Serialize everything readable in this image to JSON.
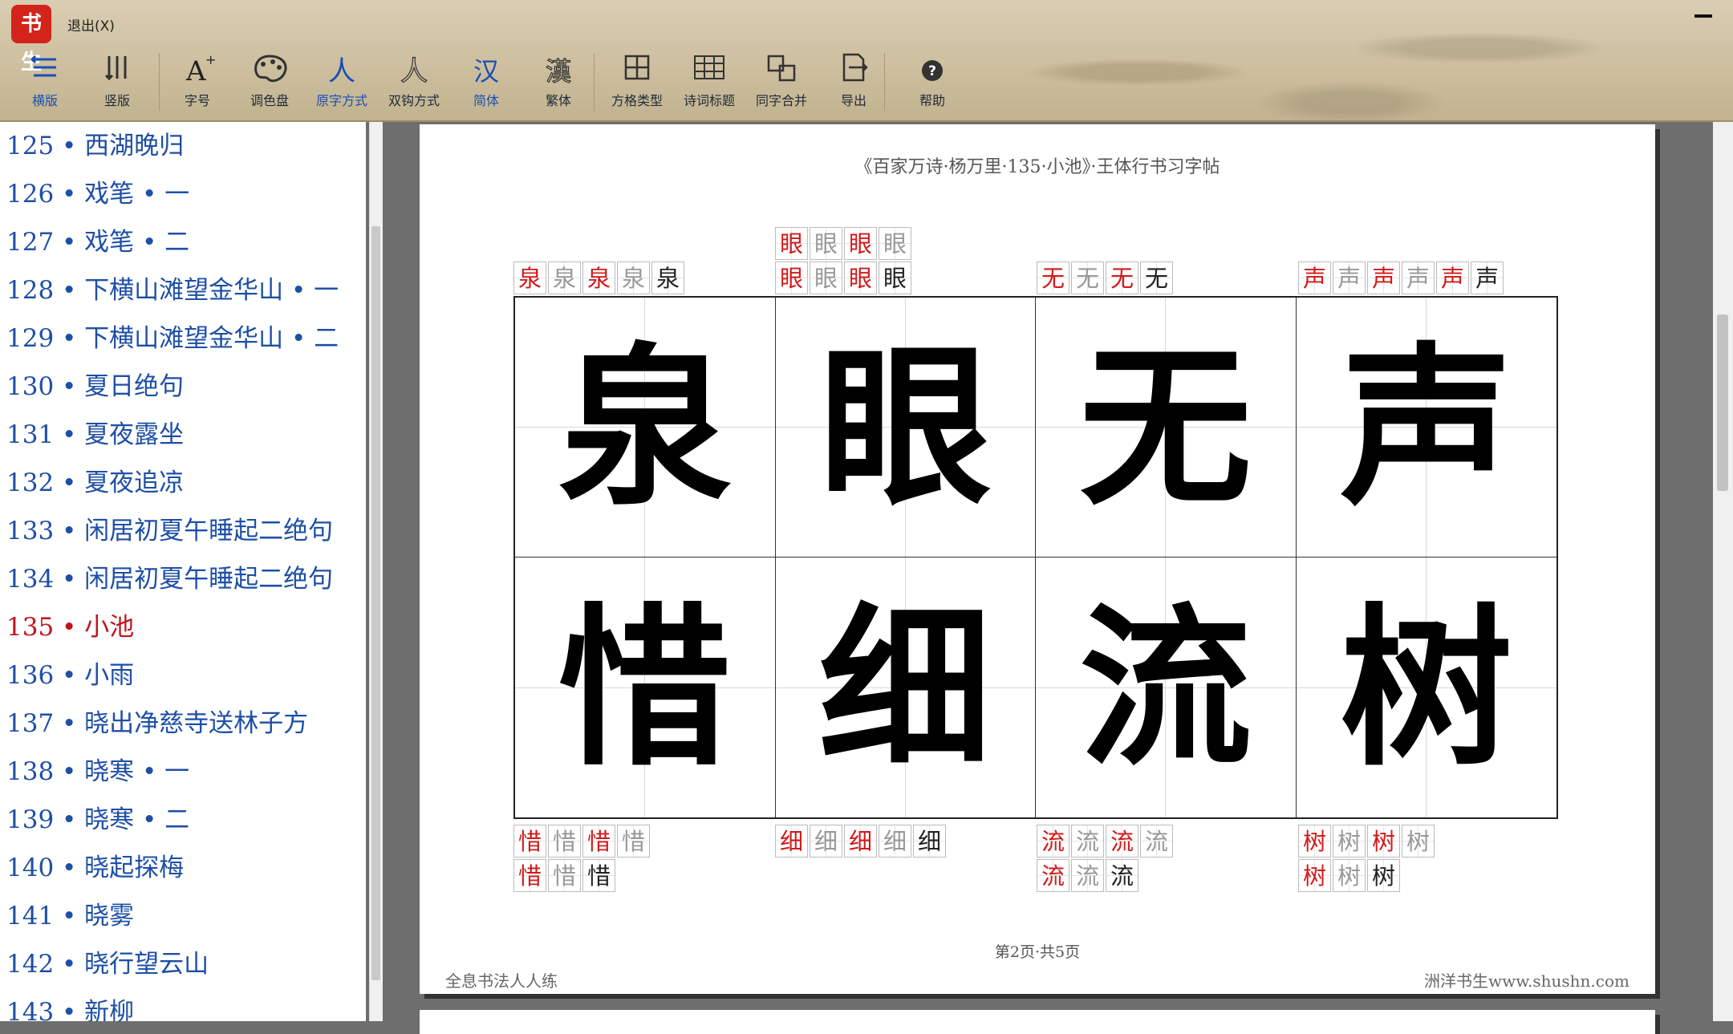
{
  "app": {
    "logo": "书生",
    "exit_label": "退出(X)"
  },
  "toolbar": [
    {
      "label": "横版",
      "icon": "landscape-layout-icon",
      "active": true
    },
    {
      "label": "竖版",
      "icon": "portrait-layout-icon",
      "active": false
    },
    {
      "label": "字号",
      "icon": "font-size-icon",
      "active": false
    },
    {
      "label": "调色盘",
      "icon": "palette-icon",
      "active": false
    },
    {
      "label": "原字方式",
      "icon": "original-char-icon",
      "active": true,
      "glyph": "人"
    },
    {
      "label": "双钩方式",
      "icon": "outline-char-icon",
      "active": false,
      "glyph": "人"
    },
    {
      "label": "简体",
      "icon": "simplified-icon",
      "active": true,
      "glyph": "汉"
    },
    {
      "label": "繁体",
      "icon": "traditional-icon",
      "active": false,
      "glyph": "漢"
    },
    {
      "label": "方格类型",
      "icon": "grid-type-icon",
      "active": false
    },
    {
      "label": "诗词标题",
      "icon": "poem-title-icon",
      "active": false
    },
    {
      "label": "同字合并",
      "icon": "merge-chars-icon",
      "active": false
    },
    {
      "label": "导出",
      "icon": "export-icon",
      "active": false
    },
    {
      "label": "帮助",
      "icon": "help-icon",
      "active": false
    }
  ],
  "sidebar": {
    "items": [
      {
        "label": "125 • 西湖晚归"
      },
      {
        "label": "126 • 戏笔 • 一"
      },
      {
        "label": "127 • 戏笔 • 二"
      },
      {
        "label": "128 • 下横山滩望金华山 • 一"
      },
      {
        "label": "129 • 下横山滩望金华山 • 二"
      },
      {
        "label": "130 • 夏日绝句"
      },
      {
        "label": "131 • 夏夜露坐"
      },
      {
        "label": "132 • 夏夜追凉"
      },
      {
        "label": "133 • 闲居初夏午睡起二绝句"
      },
      {
        "label": "134 • 闲居初夏午睡起二绝句"
      },
      {
        "label": "135 • 小池",
        "current": true
      },
      {
        "label": "136 • 小雨"
      },
      {
        "label": "137 • 晓出净慈寺送林子方"
      },
      {
        "label": "138 • 晓寒 • 一"
      },
      {
        "label": "139 • 晓寒 • 二"
      },
      {
        "label": "140 • 晓起探梅"
      },
      {
        "label": "141 • 晓雾"
      },
      {
        "label": "142 • 晓行望云山"
      },
      {
        "label": "143 • 新柳"
      }
    ]
  },
  "page": {
    "title": "《百家万诗·杨万里·135·小池》·王体行书习字帖",
    "page_number": "第2页·共5页",
    "footer_left": "全息书法人人练",
    "footer_right": "洲洋书生www.shushn.com",
    "characters": [
      "泉",
      "眼",
      "无",
      "声",
      "惜",
      "细",
      "流",
      "树"
    ],
    "stroke_steps": [
      {
        "char": "泉",
        "count": 5
      },
      {
        "char": "眼",
        "count": 8
      },
      {
        "char": "无",
        "count": 4
      },
      {
        "char": "声",
        "count": 6
      },
      {
        "char": "惜",
        "count": 7
      },
      {
        "char": "细",
        "count": 5
      },
      {
        "char": "流",
        "count": 7
      },
      {
        "char": "树",
        "count": 7
      }
    ]
  },
  "colors": {
    "accent_blue": "#1e4fa6",
    "current_red": "#c0141c",
    "stroke_red": "#d21a1a",
    "logo_red": "#d3241c"
  }
}
